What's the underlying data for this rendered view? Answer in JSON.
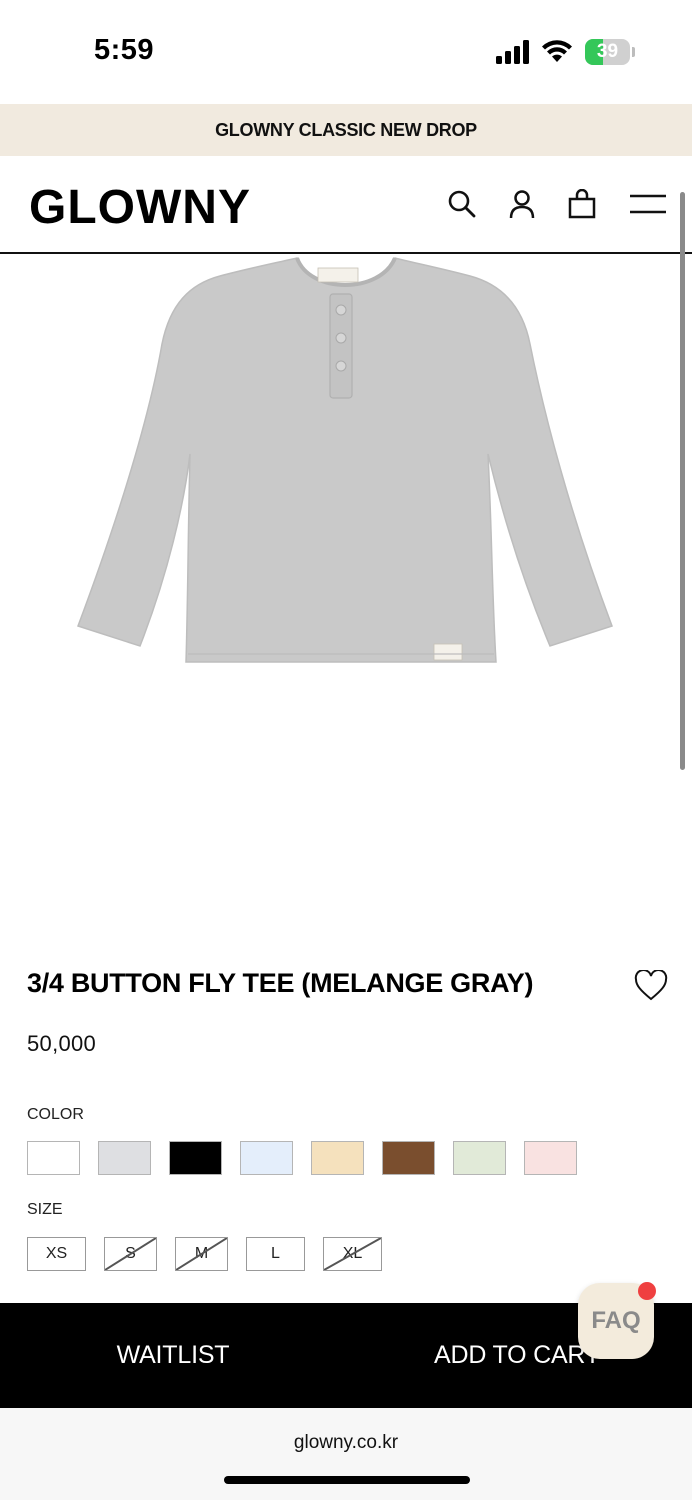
{
  "status_bar": {
    "time": "5:59",
    "battery_level": "39",
    "battery_percent": 39,
    "battery_color": "#34c759"
  },
  "promo": {
    "text": "GLOWNY CLASSIC NEW DROP"
  },
  "header": {
    "logo": "GLOWNY",
    "icons": [
      "search-icon",
      "account-icon",
      "shopping-bag-icon",
      "menu-icon"
    ]
  },
  "product": {
    "image_description": "melange gray long-sleeve henley tee",
    "image_color": "#c9c9c9",
    "title": "3/4 BUTTON FLY TEE (MELANGE GRAY)",
    "price": "50,000",
    "wishlist_icon": "heart-outline-icon"
  },
  "options": {
    "color_label": "COLOR",
    "colors": [
      {
        "name": "white",
        "hex": "#ffffff"
      },
      {
        "name": "light gray",
        "hex": "#dedfe2"
      },
      {
        "name": "black",
        "hex": "#000000"
      },
      {
        "name": "light blue",
        "hex": "#e4eefb"
      },
      {
        "name": "beige",
        "hex": "#f5e1bd"
      },
      {
        "name": "brown",
        "hex": "#7a4e2e"
      },
      {
        "name": "sage",
        "hex": "#e1ead8"
      },
      {
        "name": "light pink",
        "hex": "#f9e2e1"
      }
    ],
    "size_label": "SIZE",
    "sizes": [
      {
        "label": "XS",
        "available": true
      },
      {
        "label": "S",
        "available": false
      },
      {
        "label": "M",
        "available": false
      },
      {
        "label": "L",
        "available": true
      },
      {
        "label": "XL",
        "available": false
      }
    ]
  },
  "actions": {
    "waitlist": "WAITLIST",
    "add_to_cart": "ADD TO CART",
    "faq": "FAQ"
  },
  "browser": {
    "url": "glowny.co.kr"
  }
}
